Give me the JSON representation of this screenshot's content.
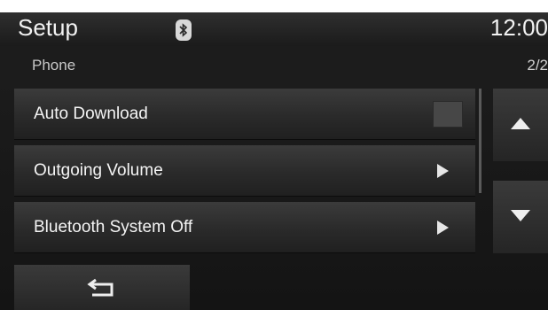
{
  "header": {
    "title": "Setup",
    "clock": "12:00",
    "bluetooth_icon": "bluetooth-icon"
  },
  "subheader": {
    "title": "Phone",
    "page": "2/2"
  },
  "menu": {
    "items": [
      {
        "label": "Auto Download",
        "control": "checkbox",
        "checked": false
      },
      {
        "label": "Outgoing Volume",
        "control": "arrow-right-icon"
      },
      {
        "label": "Bluetooth System Off",
        "control": "arrow-right-icon"
      }
    ]
  },
  "scroll": {
    "up_icon": "triangle-up-icon",
    "down_icon": "triangle-down-icon"
  },
  "footer": {
    "back_icon": "back-arrow-icon"
  },
  "colors": {
    "background": "#161616",
    "text": "#f2f2f2",
    "subtext": "#c8c8c8"
  }
}
